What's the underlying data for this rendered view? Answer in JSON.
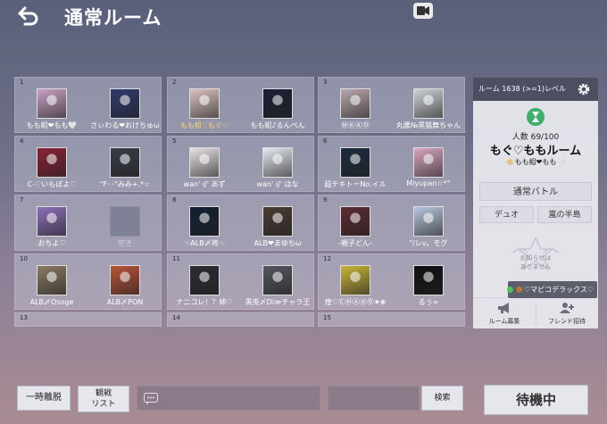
{
  "header": {
    "title": "通常ルーム"
  },
  "slots": [
    {
      "num": "1",
      "players": [
        {
          "name": "もも組❤もも🤍",
          "avatar": "#c9a2c4"
        },
        {
          "name": "さぃわる❤おけちゅω",
          "avatar": "#2f3a6e"
        }
      ]
    },
    {
      "num": "2",
      "players": [
        {
          "name": "もも組♡もぐ♡",
          "avatar": "#d9c3bf",
          "gold": true
        },
        {
          "name": "もも組♪るんぺん",
          "avatar": "#1c1f35"
        }
      ]
    },
    {
      "num": "3",
      "players": [
        {
          "name": "ⓂⓀⓀⓄ",
          "avatar": "#b9a7ad"
        },
        {
          "name": "丸腰№黒猫舞ちゃん",
          "avatar": "#cfd2d6"
        }
      ]
    },
    {
      "num": "4",
      "players": [
        {
          "name": "C-♡いもぽよ♡",
          "avatar": "#8a2236"
        },
        {
          "name": "\"F･･\"みみ+.*☆",
          "avatar": "#3a3c4a"
        }
      ]
    },
    {
      "num": "5",
      "players": [
        {
          "name": "wan' ıʃ' あず",
          "avatar": "#e8e2e6"
        },
        {
          "name": "wan' ıʃ' はな",
          "avatar": "#e6e9ef"
        }
      ]
    },
    {
      "num": "6",
      "players": [
        {
          "name": "超テキトーNo.イル",
          "avatar": "#1b2b3e"
        },
        {
          "name": "Miyupan☆*°",
          "avatar": "#d9a6c2"
        }
      ]
    },
    {
      "num": "7",
      "players": [
        {
          "name": "おちよ♡",
          "avatar": "#8d6fb8"
        },
        {
          "name": "空き",
          "empty": true
        }
      ]
    },
    {
      "num": "8",
      "players": [
        {
          "name": "☜ALB〆将☜",
          "avatar": "#122032"
        },
        {
          "name": "ALB❤まゆちω",
          "avatar": "#4a3b33"
        }
      ]
    },
    {
      "num": "9",
      "players": [
        {
          "name": "-親子どん-",
          "avatar": "#5c2a35"
        },
        {
          "name": "\"/レv。モグ",
          "avatar": "#b7c7de"
        }
      ]
    },
    {
      "num": "10",
      "players": [
        {
          "name": "ALB〆Osoge",
          "avatar": "#8a7a62"
        },
        {
          "name": "ALB〆PON",
          "avatar": "#b9543a"
        }
      ]
    },
    {
      "num": "11",
      "players": [
        {
          "name": "ナニコレ！？姉♡",
          "avatar": "#2b2c33"
        },
        {
          "name": "黒兎〆Di≫チャラ王",
          "avatar": "#55575f"
        }
      ]
    },
    {
      "num": "12",
      "players": [
        {
          "name": "煌♡ⒸⒽⒶⓇⓄ✷❀",
          "avatar": "#c8b43a"
        },
        {
          "name": "るぅ∞",
          "avatar": "#0f0f12"
        }
      ]
    },
    {
      "num": "13",
      "players": []
    },
    {
      "num": "14",
      "players": []
    },
    {
      "num": "15",
      "players": []
    }
  ],
  "panel": {
    "header": "ルーム 1638 (>=1)レベル",
    "count": "人数 69/100",
    "room_name": "もぐ♡ももルーム",
    "owner": "🔅もも組❤もも🤍",
    "mode": "通常バトル",
    "sub_left": "デュオ",
    "sub_right": "嵐の半島",
    "notice_line1": "お知らせは",
    "notice_line2": "ありません",
    "recruit": "ルーム募集",
    "invite": "フレンド招待"
  },
  "chip": {
    "text": "🔅♡マピコデラックス♡"
  },
  "bottom": {
    "leave": "一時離脱",
    "spectate_line1": "観戦",
    "spectate_line2": "リスト",
    "search": "検索",
    "wait": "待機中"
  },
  "colors": {
    "accent_green": "#3fae6a",
    "panel_header": "#4c4f62"
  }
}
